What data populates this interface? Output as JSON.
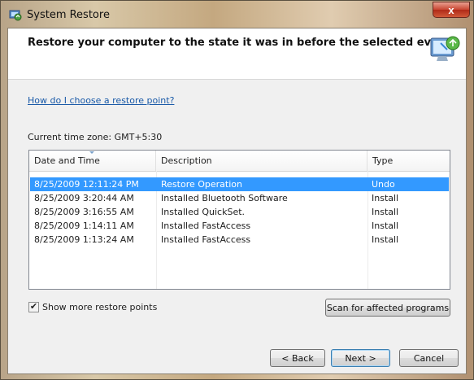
{
  "window": {
    "title": "System Restore",
    "close_glyph": "x"
  },
  "header": {
    "title": "Restore your computer to the state it was in before the selected event",
    "icon": "system-restore-monitor-icon"
  },
  "help_link": "How do I choose a restore point?",
  "timezone_label": "Current time zone: GMT+5:30",
  "table": {
    "columns": [
      "Date and Time",
      "Description",
      "Type"
    ],
    "sorted_column": "Date and Time",
    "selected_row": 0,
    "rows": [
      {
        "date": "8/25/2009 12:11:24 PM",
        "description": "Restore Operation",
        "type": "Undo"
      },
      {
        "date": "8/25/2009 3:20:44 AM",
        "description": "Installed Bluetooth Software",
        "type": "Install"
      },
      {
        "date": "8/25/2009 3:16:55 AM",
        "description": "Installed QuickSet.",
        "type": "Install"
      },
      {
        "date": "8/25/2009 1:14:11 AM",
        "description": "Installed FastAccess",
        "type": "Install"
      },
      {
        "date": "8/25/2009 1:13:24 AM",
        "description": "Installed FastAccess",
        "type": "Install"
      }
    ]
  },
  "show_more": {
    "label": "Show more restore points",
    "checked": true,
    "check_glyph": "✔"
  },
  "buttons": {
    "scan": "Scan for affected programs",
    "back": "< Back",
    "next": "Next >",
    "cancel": "Cancel"
  },
  "colors": {
    "selection": "#3399ff",
    "link": "#1a5aa8",
    "close_button": "#c84430"
  }
}
